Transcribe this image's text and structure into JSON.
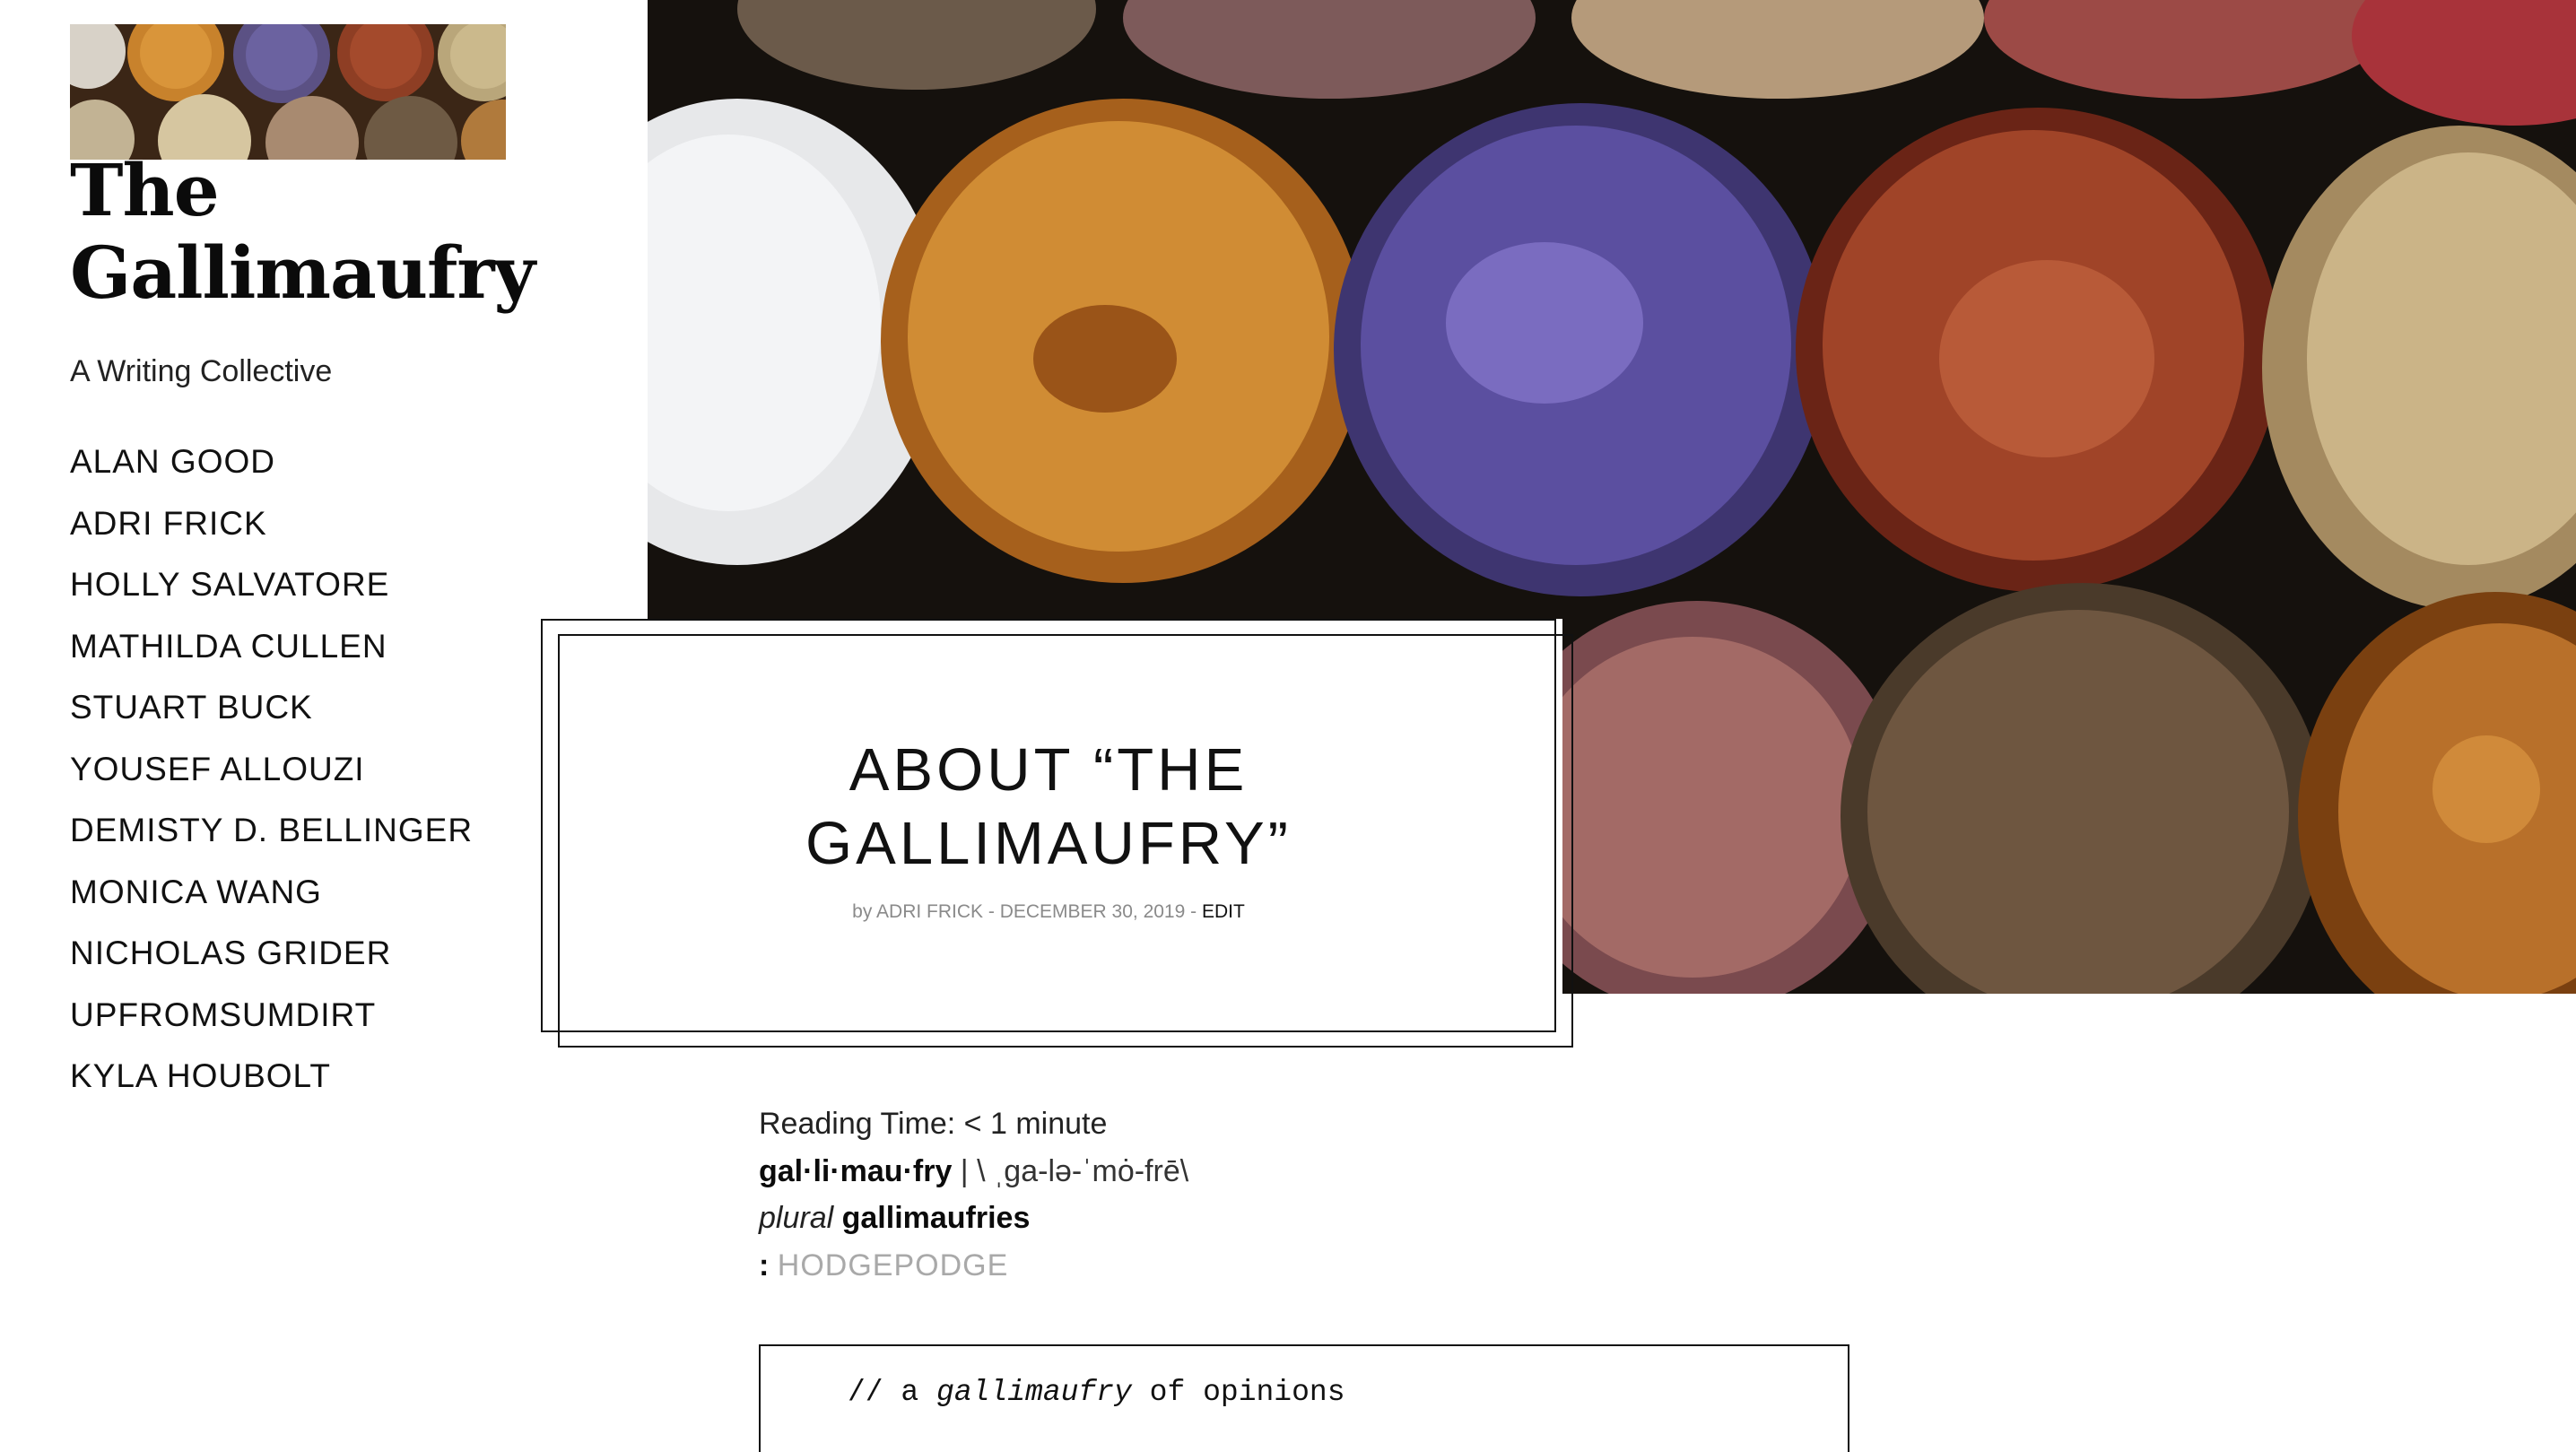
{
  "site": {
    "title_line1": "The",
    "title_line2": "Gallimaufry",
    "tagline": "A Writing Collective"
  },
  "authors": [
    "ALAN GOOD",
    "ADRI FRICK",
    "HOLLY SALVATORE",
    "MATHILDA CULLEN",
    "STUART BUCK",
    "YOUSEF ALLOUZI",
    "DEMISTY D. BELLINGER",
    "MONICA WANG",
    "NICHOLAS GRIDER",
    "UPFROMSUMDIRT",
    "KYLA HOUBOLT"
  ],
  "post": {
    "title_line1": "ABOUT “THE",
    "title_line2": "GALLIMAUFRY”",
    "meta_by": "by ADRI FRICK - DECEMBER 30, 2019",
    "meta_sep": " - ",
    "edit_label": "EDIT"
  },
  "article": {
    "reading_time": "Reading Time: < 1 minute",
    "headword": "gal·li·mau·fry",
    "pronunciation": " | \\ ˌga-lə-ˈmȯ-frē\\",
    "plural_label": "plural",
    "plural_word": "gallimaufries",
    "def_colon": ":",
    "def_link": "HODGEPODGE",
    "code_prefix": "// a ",
    "code_em": "gallimaufry",
    "code_suffix": " of opinions"
  },
  "colors": {
    "text": "#111111",
    "meta_gray": "#8a8a8a",
    "link_gray": "#a9a9a9"
  },
  "images": {
    "logo": "spice-bowls-photo",
    "hero": "spice-market-photo"
  }
}
